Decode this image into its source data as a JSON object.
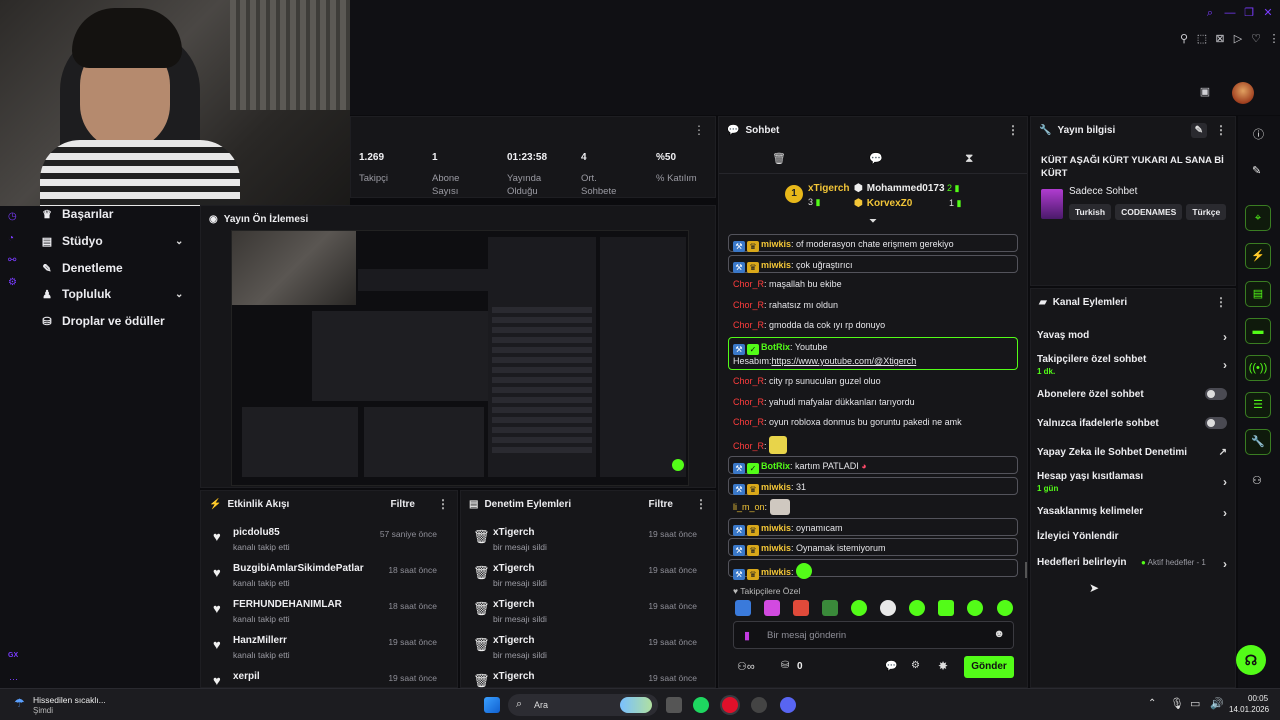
{
  "stats": [
    {
      "value": "1.269",
      "label": "Takipçi"
    },
    {
      "value": "1",
      "label": "Abone Sayısı"
    },
    {
      "value": "01:23:58",
      "label": "Yayında Olduğu"
    },
    {
      "value": "4",
      "label": "Ort. Sohbete"
    },
    {
      "value": "%50",
      "label": "% Katılım"
    }
  ],
  "nav": {
    "achievements": "Başarılar",
    "studio": "Stüdyo",
    "moderation": "Denetleme",
    "community": "Topluluk",
    "drops": "Droplar ve ödüller",
    "gx": "GX"
  },
  "preview": {
    "title": "Yayın Ön İzlemesi"
  },
  "events": {
    "title": "Etkinlik Akışı",
    "filter": "Filtre",
    "rows": [
      {
        "name": "picdolu85",
        "action": "kanalı takip etti",
        "time": "57 saniye önce"
      },
      {
        "name": "BuzgibiAmlarSikimdePatlar",
        "action": "kanalı takip etti",
        "time": "18 saat önce"
      },
      {
        "name": "FERHUNDEHANIMLAR",
        "action": "kanalı takip etti",
        "time": "18 saat önce"
      },
      {
        "name": "HanzMillerr",
        "action": "kanalı takip etti",
        "time": "19 saat önce"
      },
      {
        "name": "xerpil",
        "action": "",
        "time": "19 saat önce"
      }
    ]
  },
  "modlog": {
    "title": "Denetim Eylemleri",
    "filter": "Filtre",
    "rows": [
      {
        "name": "xTigerch",
        "action": "bir mesajı sildi",
        "time": "19 saat önce"
      },
      {
        "name": "xTigerch",
        "action": "bir mesajı sildi",
        "time": "19 saat önce"
      },
      {
        "name": "xTigerch",
        "action": "bir mesajı sildi",
        "time": "19 saat önce"
      },
      {
        "name": "xTigerch",
        "action": "bir mesajı sildi",
        "time": "19 saat önce"
      },
      {
        "name": "xTigerch",
        "action": "",
        "time": "19 saat önce"
      }
    ]
  },
  "chat": {
    "title": "Sohbet",
    "leaders": [
      {
        "rank": "1",
        "name": "xTigerch",
        "count": "3"
      },
      {
        "name": "Mohammed0173",
        "count": "2"
      },
      {
        "name": "KorvexZ0",
        "count": "1"
      }
    ],
    "messages": [
      {
        "user": "miwkis",
        "text": "of moderasyon chate erişmem gerekiyo"
      },
      {
        "user": "miwkis",
        "text": "çok uğraştırıcı"
      },
      {
        "user": "Chor_R",
        "text": "maşallah bu ekibe"
      },
      {
        "user": "Chor_R",
        "text": "rahatsız mı oldun"
      },
      {
        "user": "Chor_R",
        "text": "gmodda da cok ıyı rp donuyo"
      },
      {
        "user": "BotRix",
        "text": "Youtube",
        "text2": "Hesabım:",
        "link": "https://www.youtube.com/@Xtigerch"
      },
      {
        "user": "Chor_R",
        "text": "city rp sunucuları guzel oluo"
      },
      {
        "user": "Chor_R",
        "text": "yahudi mafyalar dükkanları tarıyordu"
      },
      {
        "user": "Chor_R",
        "text": "oyun robloxa donmus bu goruntu pakedi ne amk"
      },
      {
        "user": "Chor_R",
        "text": ""
      },
      {
        "user": "BotRix",
        "text": "kartım PATLADI"
      },
      {
        "user": "miwkis",
        "text": "31"
      },
      {
        "user": "li_m_on",
        "text": ""
      },
      {
        "user": "miwkis",
        "text": "oynamıcam"
      },
      {
        "user": "miwkis",
        "text": "Oynamak istemiyorum"
      },
      {
        "user": "miwkis",
        "text": ""
      }
    ],
    "emote_section": "Takipçilere Özel",
    "input_placeholder": "Bir mesaj gönderin",
    "points": "0",
    "send": "Gönder"
  },
  "stream_info": {
    "title": "Yayın bilgisi",
    "stream_title": "KÜRT AŞAĞI KÜRT YUKARI AL SANA Bİ KÜRT",
    "category": "Sadece Sohbet",
    "tags": [
      "Turkish",
      "CODENAMES",
      "Türkçe"
    ]
  },
  "channel_actions": {
    "title": "Kanal Eylemleri",
    "items": [
      {
        "label": "Yavaş mod",
        "sub": ""
      },
      {
        "label": "Takipçilere özel sohbet",
        "sub": "1 dk."
      },
      {
        "label": "Abonelere özel sohbet",
        "sub": ""
      },
      {
        "label": "Yalnızca ifadelerle sohbet",
        "sub": ""
      },
      {
        "label": "Yapay Zeka ile Sohbet Denetimi",
        "sub": ""
      },
      {
        "label": "Hesap yaşı kısıtlaması",
        "sub": "1 gün"
      },
      {
        "label": "Yasaklanmış kelimeler",
        "sub": ""
      },
      {
        "label": "İzleyici Yönlendir",
        "sub": ""
      },
      {
        "label": "Hedefleri belirleyin",
        "sub": "Aktif hedefler - 1"
      }
    ]
  },
  "taskbar": {
    "weather": "Hissedilen sıcaklı...",
    "weather_sub": "Şimdi",
    "search": "Ara",
    "time": "00:05",
    "date": "14.01.2026"
  },
  "colors": {
    "accent": "#53fc18",
    "bg": "#0b0b0e",
    "panel": "#161619",
    "brand_purple": "#7a3cff"
  }
}
